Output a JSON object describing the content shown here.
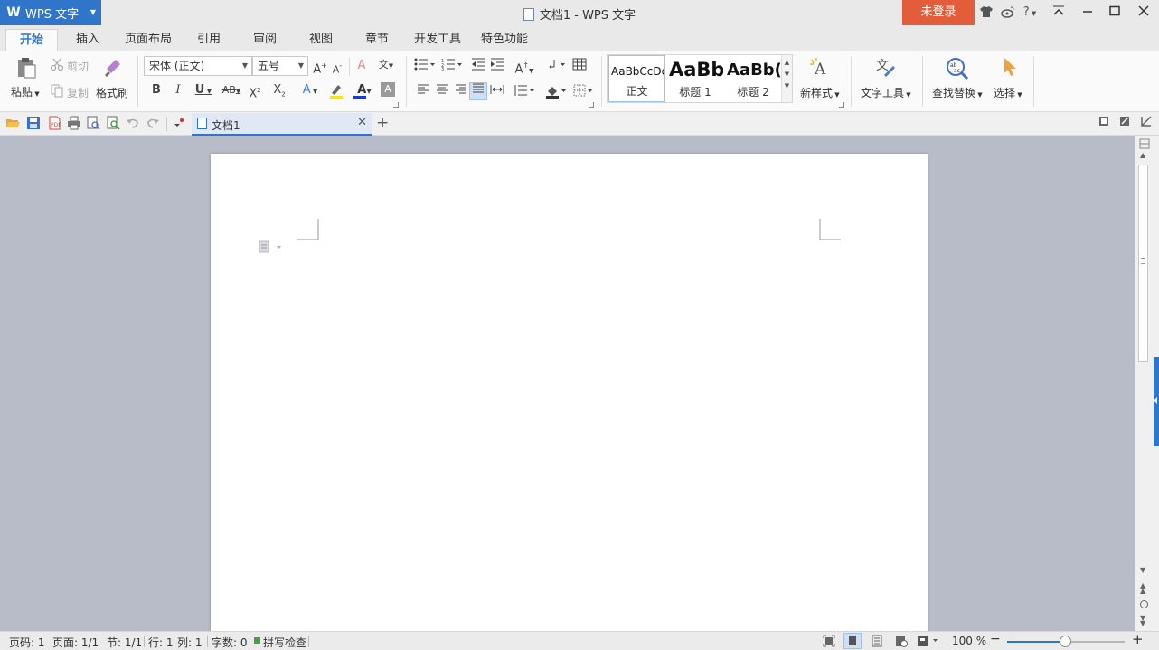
{
  "titlebar": {
    "app_name": "WPS 文字",
    "window_title": "文档1 - WPS 文字",
    "login_label": "未登录",
    "help_label": "?"
  },
  "menu_tabs": [
    "开始",
    "插入",
    "页面布局",
    "引用",
    "审阅",
    "视图",
    "章节",
    "开发工具",
    "特色功能"
  ],
  "ribbon": {
    "clipboard": {
      "paste": "粘贴",
      "cut": "剪切",
      "copy": "复制",
      "format_painter": "格式刷"
    },
    "font": {
      "font_family": "宋体 (正文)",
      "font_size": "五号"
    },
    "styles": [
      {
        "sample": "AaBbCcDd",
        "name": "正文"
      },
      {
        "sample": "AaBb",
        "name": "标题 1"
      },
      {
        "sample": "AaBb(",
        "name": "标题 2"
      }
    ],
    "new_style": "新样式",
    "text_tools": "文字工具",
    "find_replace": "查找替换",
    "select": "选择"
  },
  "doc_tab": {
    "name": "文档1"
  },
  "statusbar": {
    "page_num": "页码: 1",
    "page_count": "页面: 1/1",
    "section": "节: 1/1",
    "row": "行: 1",
    "col": "列: 1",
    "word_count": "字数: 0",
    "spell_check": "拼写检查",
    "zoom": "100 %"
  },
  "zoom_level": 0.5,
  "colors": {
    "accent": "#2f75c9",
    "login": "#e35d3a",
    "canvas": "#b8bcc8"
  }
}
